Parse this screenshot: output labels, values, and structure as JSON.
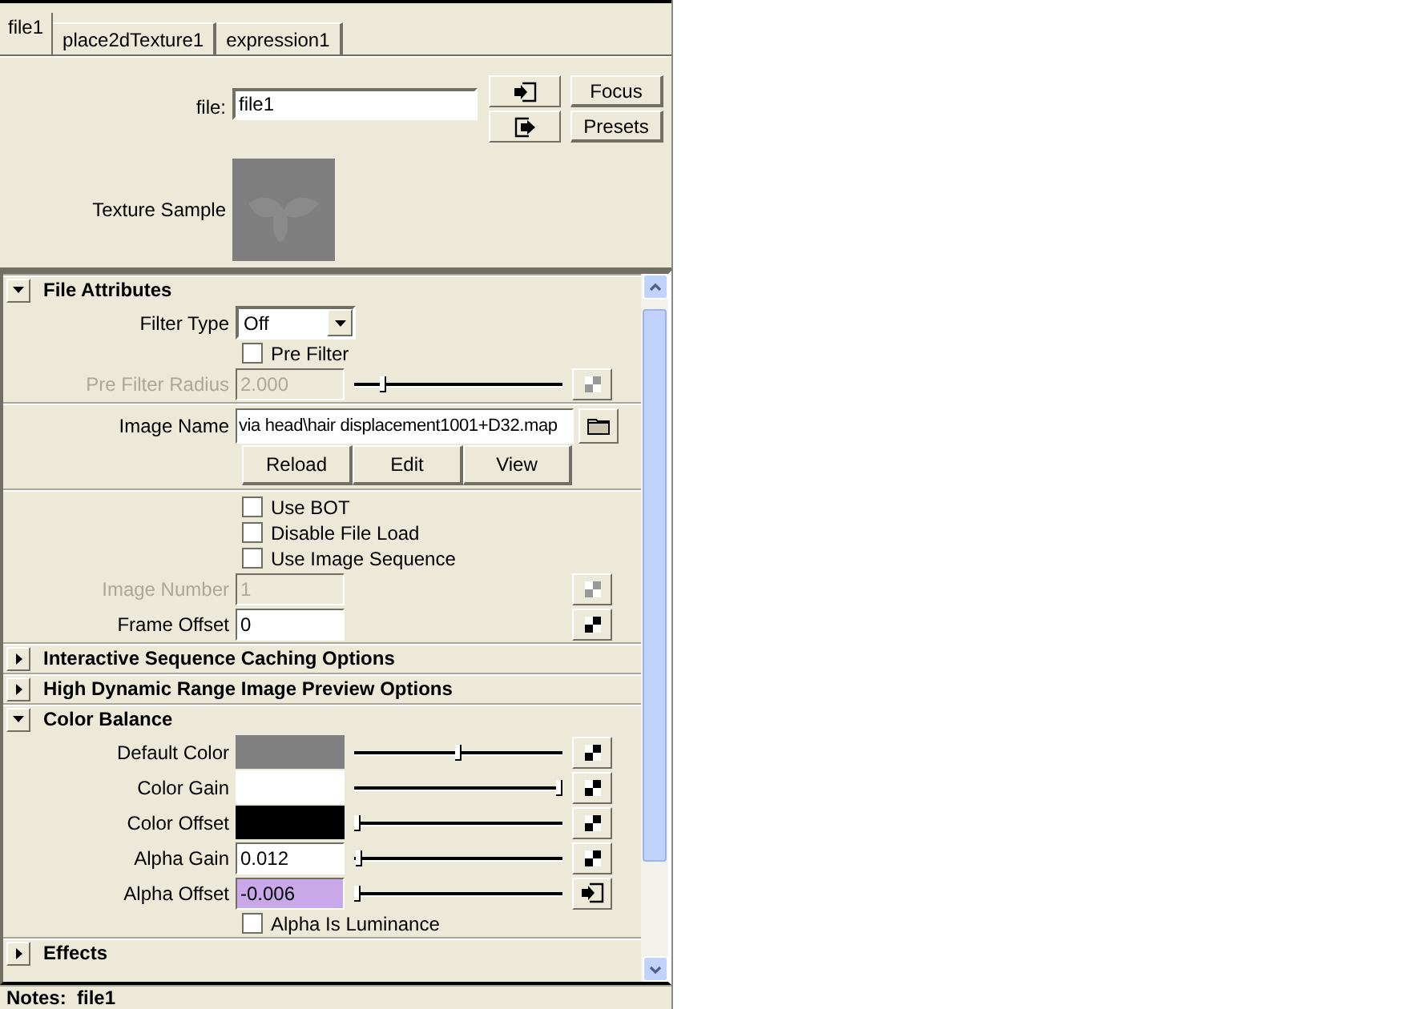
{
  "tabs": [
    {
      "label": "file1",
      "selected": true
    },
    {
      "label": "place2dTexture1",
      "selected": false
    },
    {
      "label": "expression1",
      "selected": false
    }
  ],
  "node": {
    "label": "file:",
    "value": "file1"
  },
  "node_buttons": [
    {
      "kind": "input"
    },
    {
      "kind": "output"
    }
  ],
  "side_buttons": [
    "Focus",
    "Presets"
  ],
  "texture_sample": {
    "label": "Texture Sample"
  },
  "sections": [
    {
      "title": "File Attributes",
      "expanded": true,
      "groups": [
        [
          {
            "kind": "dropdown",
            "label": "Filter Type",
            "value": "Off"
          },
          {
            "kind": "checkbox",
            "label": "Pre Filter",
            "checked": false
          },
          {
            "kind": "slider",
            "label": "Pre Filter Radius",
            "value": "2.000",
            "level": 0.13,
            "disabled": true,
            "map_button": {
              "kind": "checker"
            }
          }
        ],
        [
          {
            "kind": "file",
            "label": "Image Name",
            "value": "via head\\hair displacement1001+D32.map"
          },
          {
            "kind": "buttons",
            "buttons": [
              "Reload",
              "Edit",
              "View"
            ]
          }
        ],
        [
          {
            "kind": "checkbox",
            "label": "Use BOT",
            "checked": false
          },
          {
            "kind": "checkbox",
            "label": "Disable File Load",
            "checked": false
          },
          {
            "kind": "checkbox",
            "label": "Use Image Sequence",
            "checked": false
          },
          {
            "kind": "field",
            "label": "Image Number",
            "value": "1",
            "disabled": true,
            "map_button": {
              "kind": "checker"
            }
          },
          {
            "kind": "field",
            "label": "Frame Offset",
            "value": "0",
            "disabled": false,
            "map_button": {
              "kind": "checker"
            }
          }
        ]
      ]
    },
    {
      "title": "Interactive Sequence Caching Options",
      "expanded": false
    },
    {
      "title": "High Dynamic Range Image Preview Options",
      "expanded": false
    },
    {
      "title": "Color Balance",
      "expanded": true,
      "groups": [
        [
          {
            "kind": "color",
            "label": "Default Color",
            "color": "#808080",
            "level": 0.5,
            "map_button": {
              "kind": "checker"
            }
          },
          {
            "kind": "color",
            "label": "Color Gain",
            "color": "#ffffff",
            "level": 1,
            "map_button": {
              "kind": "checker"
            }
          },
          {
            "kind": "color",
            "label": "Color Offset",
            "color": "#000000",
            "level": 0,
            "map_button": {
              "kind": "checker"
            }
          },
          {
            "kind": "slider",
            "label": "Alpha Gain",
            "value": "0.012",
            "level": 0.01,
            "disabled": false,
            "connected": false,
            "map_button": {
              "kind": "checker"
            }
          },
          {
            "kind": "slider",
            "label": "Alpha Offset",
            "value": "-0.006",
            "level": 0,
            "disabled": false,
            "connected": true,
            "map_button": {
              "kind": "input"
            }
          },
          {
            "kind": "checkbox",
            "label": "Alpha Is Luminance",
            "checked": false
          }
        ]
      ]
    },
    {
      "title": "Effects",
      "expanded": false
    }
  ],
  "notes": "Notes:  file1"
}
